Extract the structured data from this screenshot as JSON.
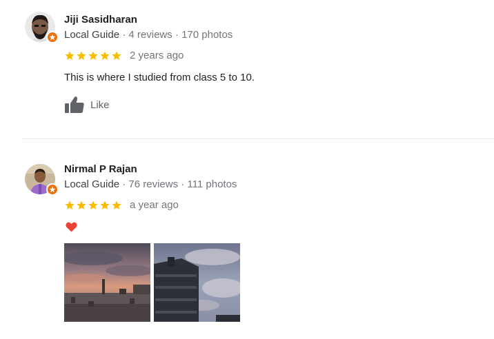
{
  "reviews": [
    {
      "name": "Jiji Sasidharan",
      "guide_label": "Local Guide",
      "stats": " · 4 reviews · 170 photos",
      "rating": 5,
      "time": "2 years ago",
      "text": "This is where I studied from class 5 to 10.",
      "like_label": "Like"
    },
    {
      "name": "Nirmal P Rajan",
      "guide_label": "Local Guide",
      "stats": " · 76 reviews · 111 photos",
      "rating": 5,
      "time": "a year ago",
      "emoji": "heart",
      "photos": [
        "sunset-rooftop-photo",
        "building-sky-photo"
      ]
    }
  ],
  "colors": {
    "star": "#fbbc04",
    "badge": "#e8710a",
    "heart": "#ea4335",
    "name": "#202124",
    "meta": "#70757a"
  },
  "icons": [
    "star-icon",
    "thumbs-up-icon",
    "heart-icon",
    "local-guide-badge-icon"
  ]
}
